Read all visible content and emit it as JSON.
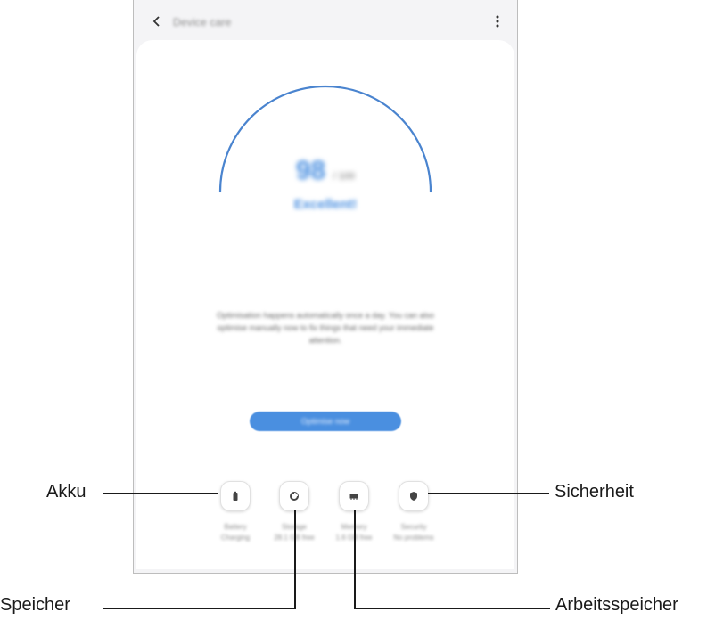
{
  "app": {
    "title": "Device care"
  },
  "score": {
    "value": "98",
    "max": "/ 100",
    "status": "Excellent!"
  },
  "description": "Optimisation happens automatically once a day. You can also optimise manually now to fix things that need your immediate attention.",
  "optimize_button": "Optimise now",
  "features": [
    {
      "icon": "battery-icon",
      "label": "Battery\nCharging"
    },
    {
      "icon": "storage-icon",
      "label": "Storage\n28.1 GB free"
    },
    {
      "icon": "memory-icon",
      "label": "Memory\n1.6 GB free"
    },
    {
      "icon": "security-icon",
      "label": "Security\nNo problems"
    }
  ],
  "callouts": {
    "akku": "Akku",
    "speicher": "Speicher",
    "sicherheit": "Sicherheit",
    "arbeitsspeicher": "Arbeitsspeicher"
  },
  "colors": {
    "accent": "#4a8fe0"
  }
}
